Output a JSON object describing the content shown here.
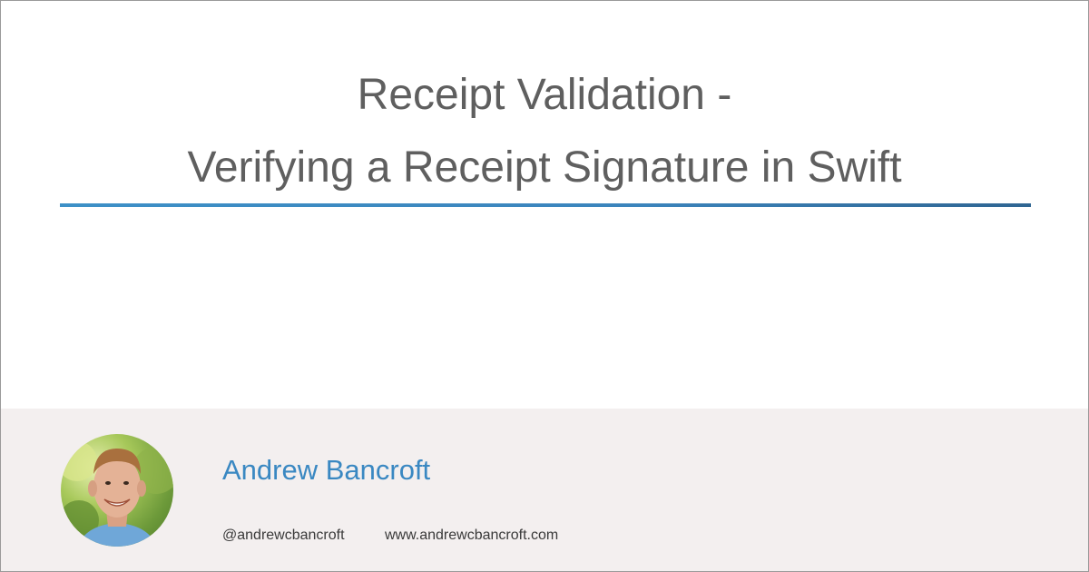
{
  "title": {
    "line1": "Receipt Validation -",
    "line2": "Verifying a Receipt Signature in Swift"
  },
  "author": {
    "name": "Andrew Bancroft",
    "handle": "@andrewcbancroft",
    "website": "www.andrewcbancroft.com"
  },
  "colors": {
    "title_text": "#5f5f5f",
    "accent": "#3a88c2",
    "footer_background": "#f3efef",
    "border": "#9a9a9a"
  },
  "icons": {
    "avatar": "author-photo"
  }
}
